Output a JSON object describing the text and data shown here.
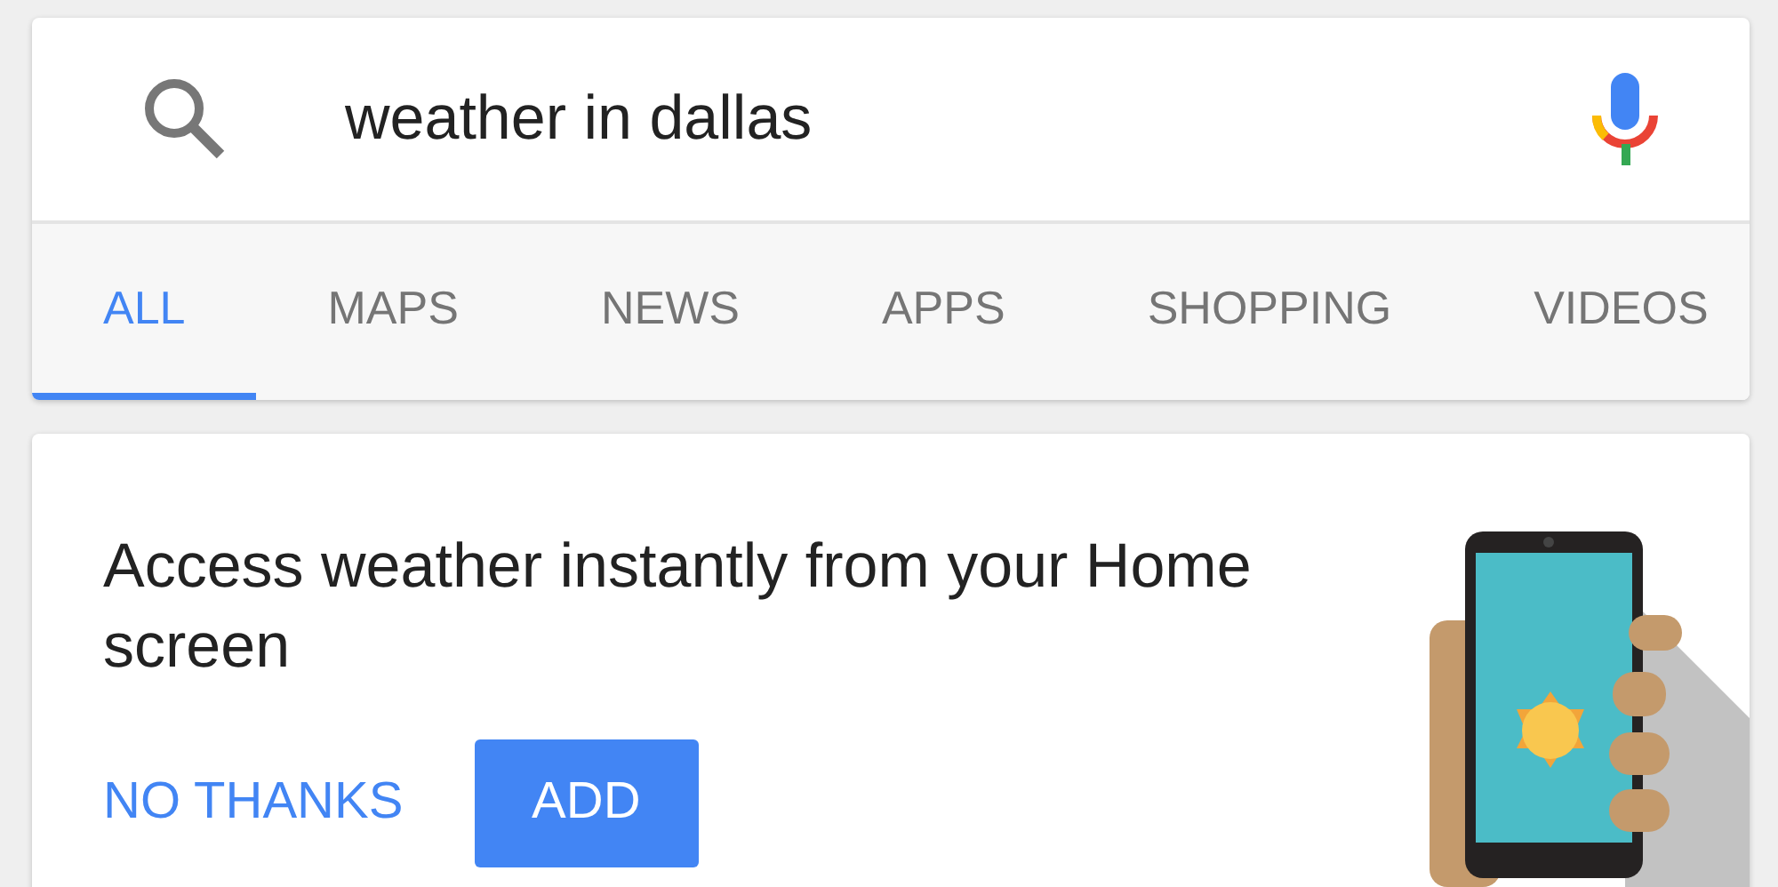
{
  "search": {
    "query": "weather in dallas"
  },
  "tabs": [
    {
      "label": "ALL",
      "selected": true
    },
    {
      "label": "MAPS",
      "selected": false
    },
    {
      "label": "NEWS",
      "selected": false
    },
    {
      "label": "APPS",
      "selected": false
    },
    {
      "label": "SHOPPING",
      "selected": false
    },
    {
      "label": "VIDEOS",
      "selected": false
    }
  ],
  "promo": {
    "headline": "Access weather instantly from your Home screen",
    "buttons": [
      {
        "label": "NO THANKS",
        "kind": "text"
      },
      {
        "label": "ADD",
        "kind": "filled"
      }
    ]
  }
}
